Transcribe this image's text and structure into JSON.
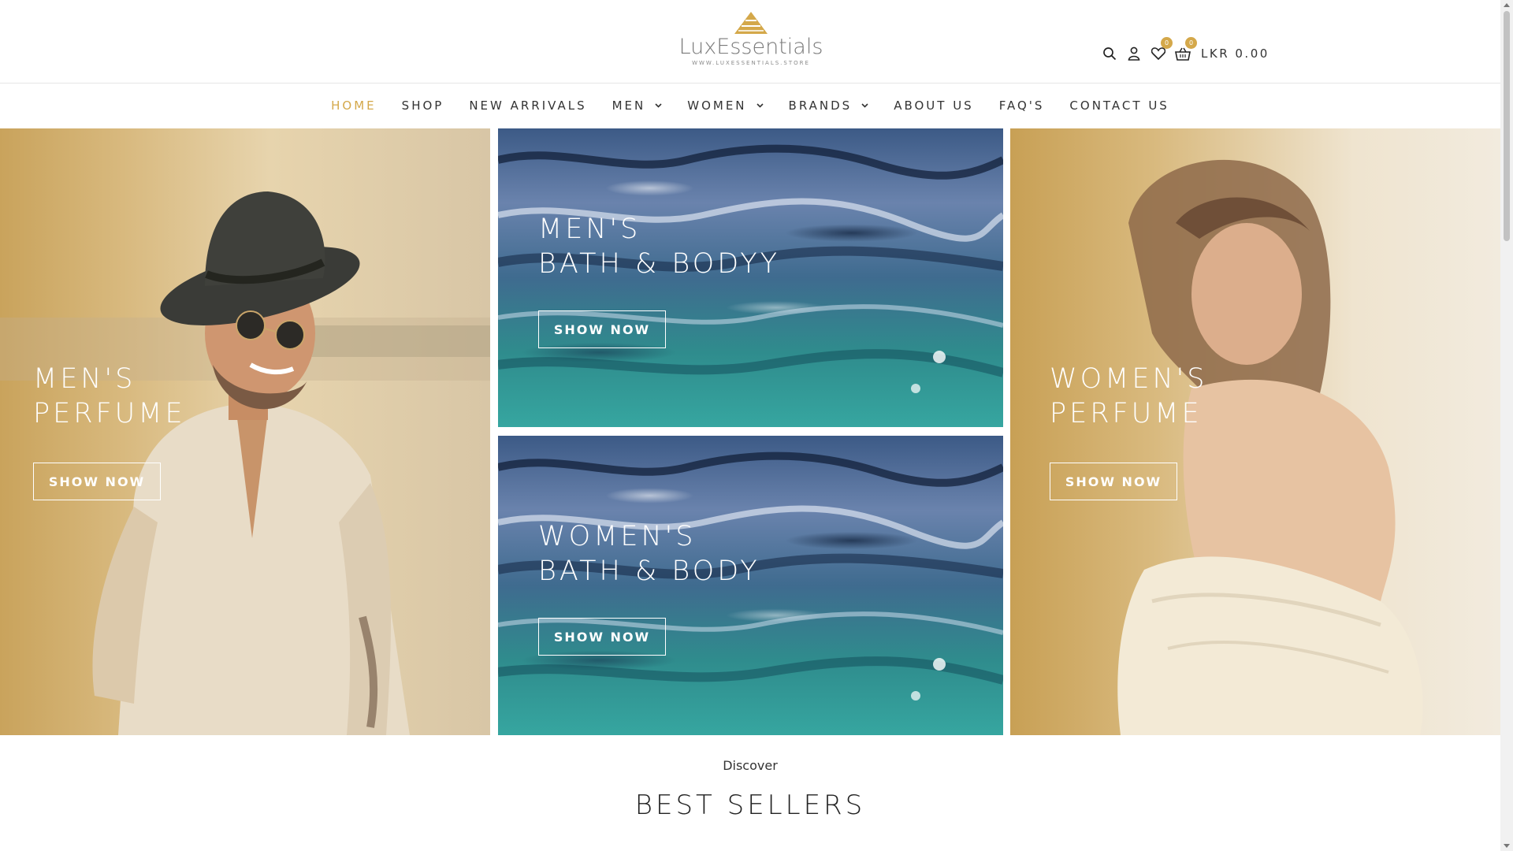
{
  "brand": {
    "name": "LuxEssentials",
    "url": "WWW.LUXESSENTIALS.STORE",
    "accent": "#d4a84a"
  },
  "header": {
    "icons": [
      "search-icon",
      "user-icon",
      "heart-icon",
      "basket-icon"
    ],
    "wishlist_count": "0",
    "cart_count": "0",
    "cart_total": "LKR 0.00"
  },
  "nav": {
    "items": [
      {
        "label": "HOME",
        "active": true
      },
      {
        "label": "SHOP"
      },
      {
        "label": "NEW ARRIVALS"
      },
      {
        "label": "MEN",
        "dropdown": true
      },
      {
        "label": "WOMEN",
        "dropdown": true
      },
      {
        "label": "BRANDS",
        "dropdown": true
      },
      {
        "label": "ABOUT US"
      },
      {
        "label": "FAQ'S"
      },
      {
        "label": "CONTACT US"
      }
    ]
  },
  "hero": {
    "left": {
      "line1": "MEN'S",
      "line2": "PERFUME",
      "button": "SHOW NOW"
    },
    "mid_top": {
      "line1": "MEN'S",
      "line2": "BATH & BODYY",
      "button": "SHOW NOW"
    },
    "mid_bottom": {
      "line1": "WOMEN'S",
      "line2": "BATH & BODY",
      "button": "SHOW NOW"
    },
    "right": {
      "line1": "WOMEN'S",
      "line2": "PERFUME",
      "button": "SHOW NOW"
    }
  },
  "section": {
    "eyebrow": "Discover",
    "title": "BEST SELLERS"
  }
}
